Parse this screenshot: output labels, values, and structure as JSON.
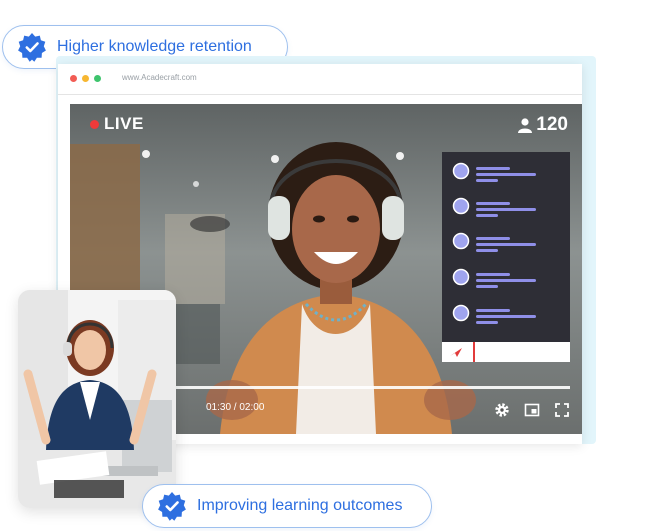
{
  "badges": {
    "top": "Higher knowledge retention",
    "bottom": "Improving learning outcomes"
  },
  "browser": {
    "url": "www.Acadecraft.com",
    "dots": [
      "#f25c54",
      "#f7b731",
      "#3ec46d"
    ]
  },
  "video": {
    "live_label": "LIVE",
    "viewer_count": "120",
    "time": "01:30 / 02:00",
    "progress": 0.0
  },
  "chat": {
    "message_count": 5
  },
  "colors": {
    "accent": "#2e6fe0",
    "badge_border": "#9ec0ee",
    "chat_bg": "#2e2e36",
    "chat_avatar": "#9fa4ef",
    "chat_line": "#8f8fe8",
    "live_dot": "#f03a3a",
    "send_arrow": "#e23b3b"
  },
  "icons": {
    "badge": "verified-seal-icon",
    "viewers": "person-icon",
    "send": "send-arrow-icon",
    "settings": "gear-icon",
    "miniplayer": "miniplayer-icon",
    "fullscreen": "fullscreen-icon"
  }
}
